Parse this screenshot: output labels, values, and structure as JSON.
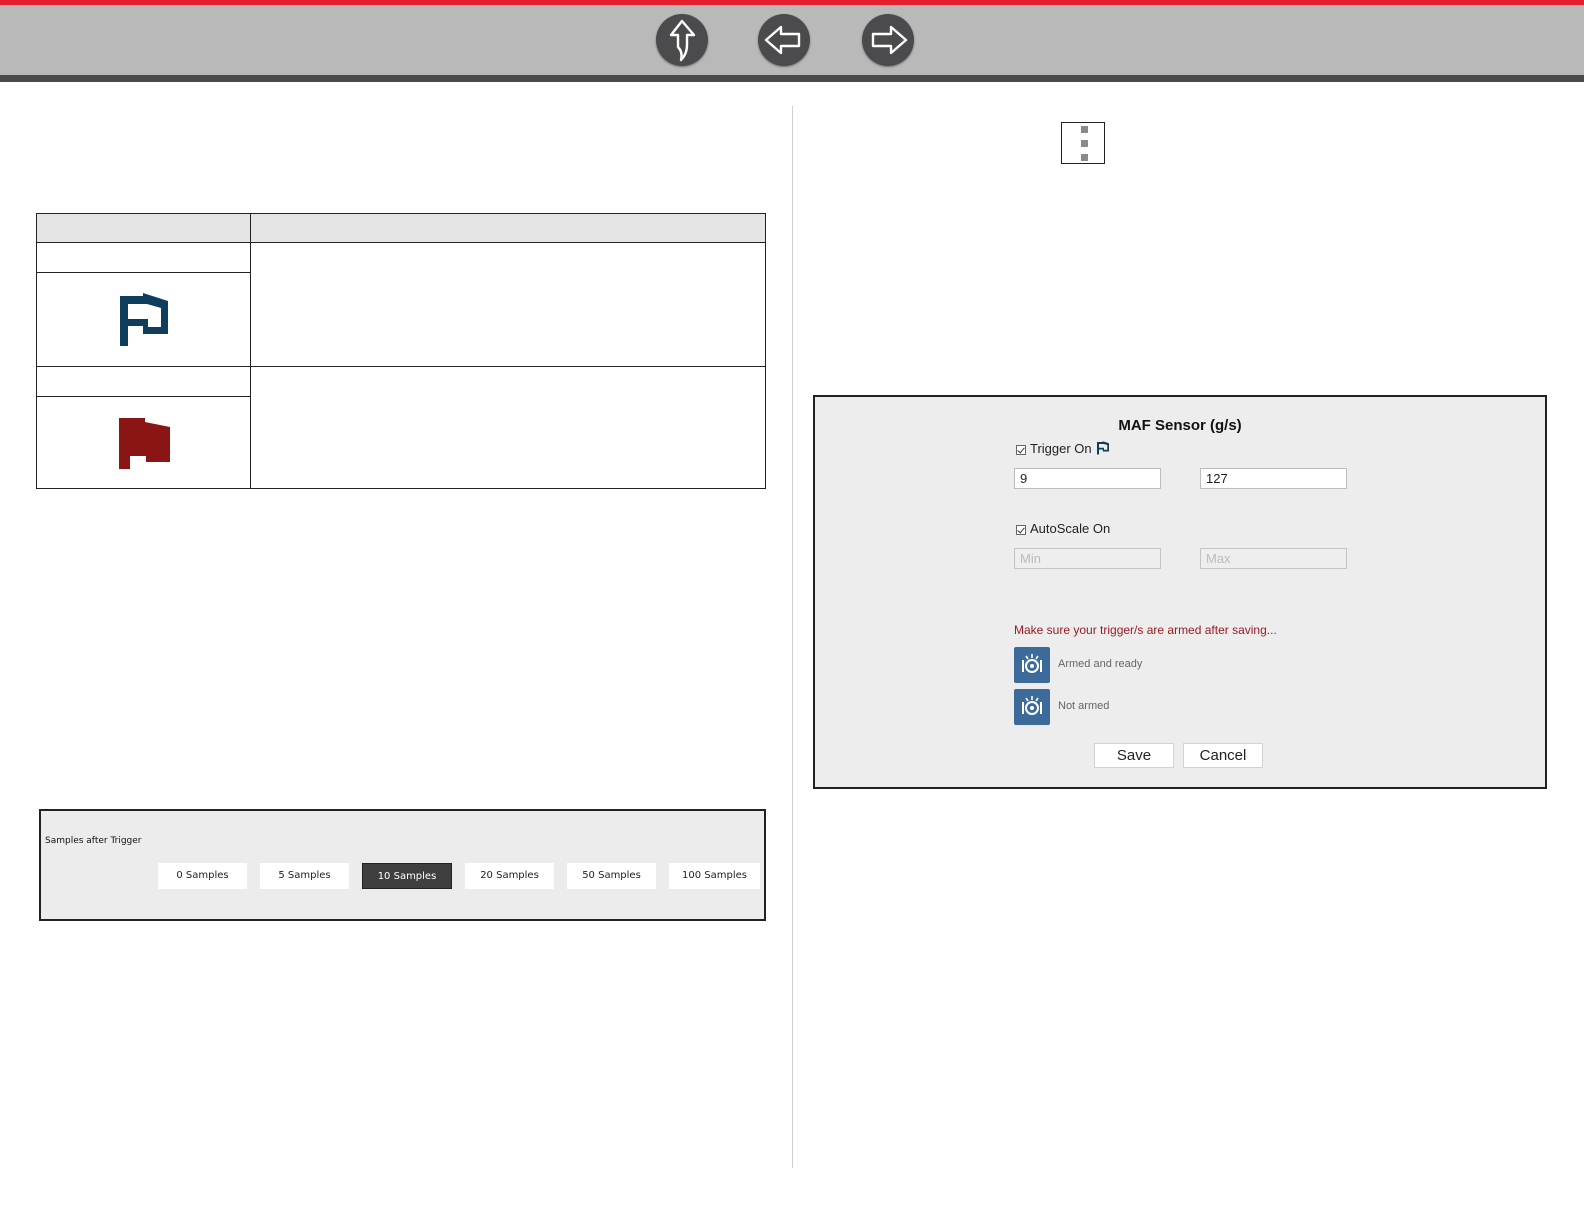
{
  "nav": {
    "buttons": [
      {
        "name": "up",
        "icon": "arrow-up-icon"
      },
      {
        "name": "back",
        "icon": "arrow-left-icon"
      },
      {
        "name": "forward",
        "icon": "arrow-right-icon"
      }
    ],
    "colors": {
      "accent": "#e4202e",
      "bar": "#b9b9b9",
      "button": "#4b4b4d"
    }
  },
  "icon_table": {
    "rows": [
      {
        "icon": "trigger-flag-outline-icon",
        "color": "#0f3d5c"
      },
      {
        "icon": "trigger-flag-filled-icon",
        "color": "#8b1414"
      }
    ]
  },
  "samples_panel": {
    "label": "Samples after Trigger",
    "options": [
      "0 Samples",
      "5 Samples",
      "10 Samples",
      "20 Samples",
      "50 Samples",
      "100 Samples"
    ],
    "selected": "10 Samples"
  },
  "more_menu": {
    "icon": "more-vertical-icon"
  },
  "dialog": {
    "title": "MAF Sensor (g/s)",
    "trigger": {
      "label": "Trigger On",
      "checked": true,
      "icon": "trigger-flag-outline-icon",
      "value_low": "9",
      "value_high": "127"
    },
    "autoscale": {
      "label": "AutoScale On",
      "checked": true,
      "min_placeholder": "Min",
      "max_placeholder": "Max"
    },
    "warning": "Make sure your trigger/s are armed after saving...",
    "warning_color": "#9b1b22",
    "arm_states": [
      {
        "label": "Armed and ready",
        "icon": "trigger-armed-icon"
      },
      {
        "label": "Not armed",
        "icon": "trigger-not-armed-icon"
      }
    ],
    "save_label": "Save",
    "cancel_label": "Cancel"
  }
}
